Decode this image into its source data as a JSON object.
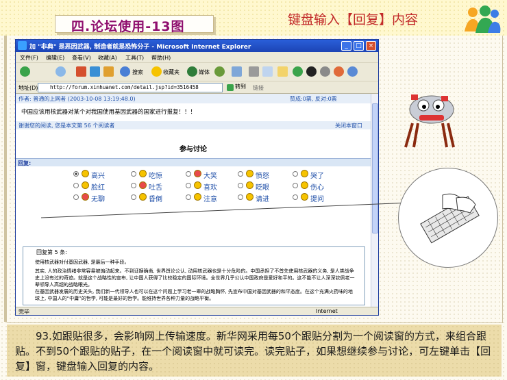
{
  "slide": {
    "title": "四.论坛使用-13图",
    "subtitle": "键盘输入【回复】内容",
    "caption": "93.如跟贴很多，会影响网上传输速度。新华网采用每50个跟贴分割为一个阅读窗的方式，来组合跟贴。不到50个跟贴的贴子，在一个阅读窗中就可读完。读完贴子，如果想继续参与讨论，可左键单击【回复】窗，键盘输入回复的内容。"
  },
  "browser": {
    "title": "加 \"非典\" 是恶因武器, 制造者就是恐怖分子 - Microsoft Internet Explorer",
    "menu": [
      "文件(F)",
      "编辑(E)",
      "查看(V)",
      "收藏(A)",
      "工具(T)",
      "帮助(H)"
    ],
    "toolbar": {
      "search": "搜索",
      "favorites": "收藏夹",
      "media": "媒体"
    },
    "address_label": "地址(D)",
    "address": "http://forum.xinhuanet.com/detail.jsp?id=3516458",
    "go": "转到",
    "links": "链接",
    "status_left": "完毕",
    "status_right": "Internet"
  },
  "post": {
    "author": "作者: 普通的上网者 (2003-10-08 13:19:48.0)",
    "votes": "赞成:0票, 反对:0票",
    "body": "中国应该用核武器对某个对我国使用基因武器的国家进行报复！！！",
    "notice": "谢谢您的阅读, 您是本文第 56 个阅读者",
    "close_window": "关闭本窗口"
  },
  "discussion": {
    "title": "参与讨论",
    "reply_label": "回复:",
    "moods": [
      [
        "高兴",
        "吃惊",
        "大笑",
        "愤怒",
        "哭了"
      ],
      [
        "脸红",
        "吐舌",
        "喜欢",
        "眨眼",
        "伤心"
      ],
      [
        "无聊",
        "昏倒",
        "注意",
        "请进",
        "提问"
      ]
    ]
  },
  "reply": {
    "first_line": "回复第 5 条:",
    "lines": [
      "使用核武器对付基因武器, 是最后一种手段。",
      "其实, 人的政治情绪非常容易被煽动起来。不到证据确凿, 世界舆论公认, 动用核武器也是十分危险的。中国承担了不首先使用核武器的义务, 是人类战争史上没有过的奇迹。就是这个战略性的宣布, 让中国人获得了比较稳定的国际环境。全世界几乎公认中国政府是爱好和平的。这不能不让人深深钦佩老一辈领导人高超的战略眼光。",
      "在基因武器发展的历史关头, 我们新一代领导人也可以在这个问题上学习老一辈的战略胸怀, 先宣布中国对基因武器的和平态度。在这个充满火药味的地球上, 中国人的“中庸”的哲学, 可能是最好的哲学。能维持世界各种力量的战略平衡。"
    ]
  },
  "colors": {
    "accent": "#8f0e6e",
    "subtitle": "#c22a2a",
    "ie_title": "#1c44b5",
    "caption_bg": "#ecdcaa"
  }
}
